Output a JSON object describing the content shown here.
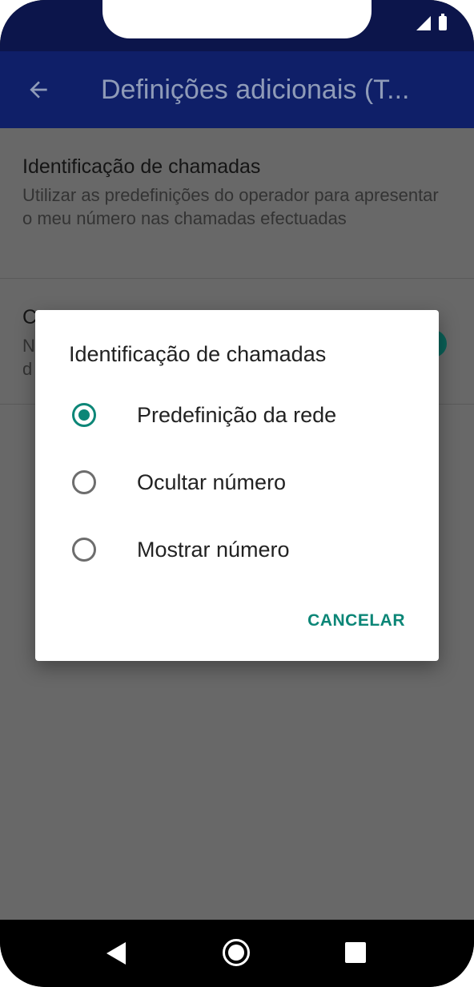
{
  "app_bar": {
    "title": "Definições adicionais (T..."
  },
  "preferences": [
    {
      "title": "Identificação de chamadas",
      "summary": "Utilizar as predefinições do operador para apresentar o meu número nas chamadas efectuadas"
    },
    {
      "title": "C",
      "summary": "N",
      "summary_line2": "d"
    }
  ],
  "dialog": {
    "title": "Identificação de chamadas",
    "options": [
      {
        "label": "Predefinição da rede",
        "selected": true
      },
      {
        "label": "Ocultar número",
        "selected": false
      },
      {
        "label": "Mostrar número",
        "selected": false
      }
    ],
    "cancel_label": "CANCELAR"
  },
  "colors": {
    "status_bar": "#0c154b",
    "app_bar": "#0f1f68",
    "accent": "#0c8677",
    "scrim_background": "#686868"
  },
  "icons": {
    "back": "arrow-left-icon",
    "nav_back": "triangle-back-icon",
    "nav_home": "circle-home-icon",
    "nav_recent": "square-recents-icon"
  }
}
